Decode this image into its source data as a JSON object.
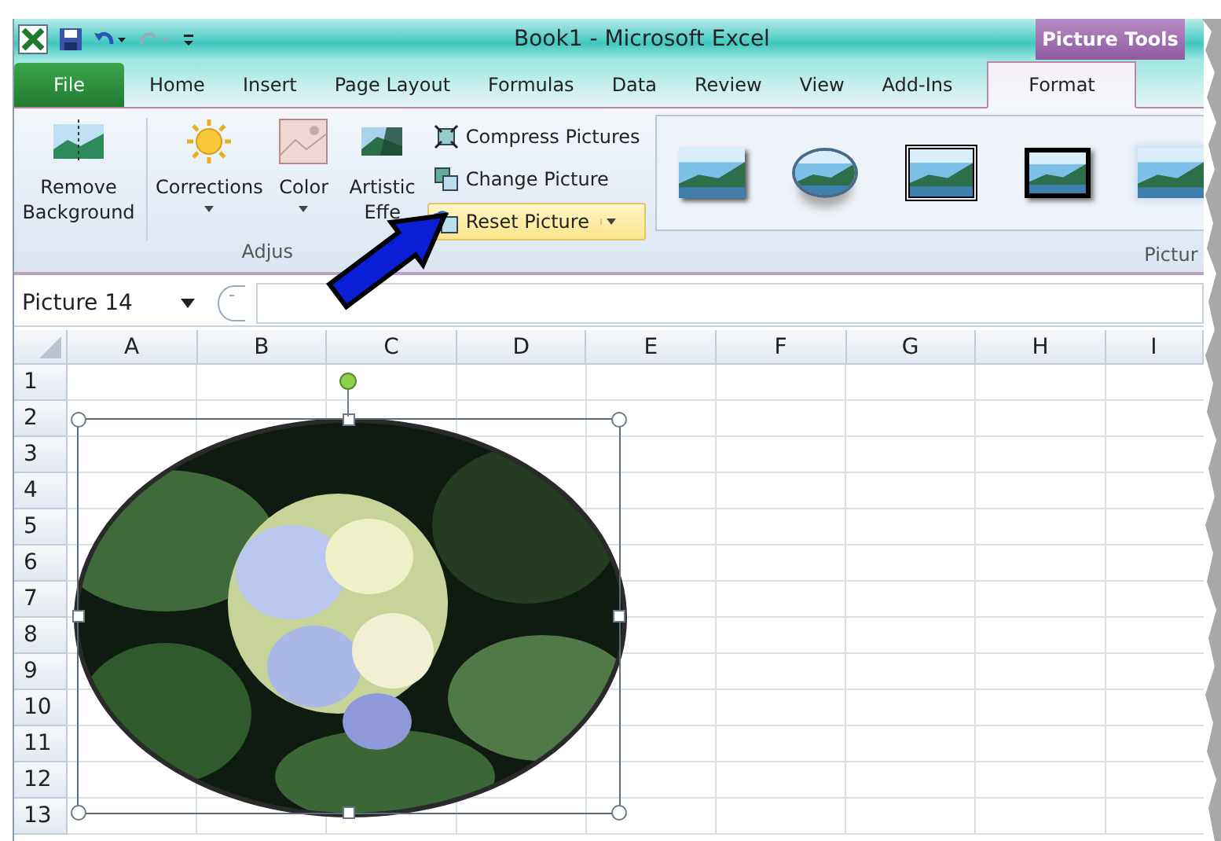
{
  "title_bar": {
    "title": "Book1 - Microsoft Excel",
    "context_tab": "Picture Tools"
  },
  "tabs": [
    {
      "label": "File",
      "kind": "file",
      "selected": false
    },
    {
      "label": "Home",
      "kind": "tab",
      "selected": false
    },
    {
      "label": "Insert",
      "kind": "tab",
      "selected": false
    },
    {
      "label": "Page Layout",
      "kind": "tab",
      "selected": false
    },
    {
      "label": "Formulas",
      "kind": "tab",
      "selected": false
    },
    {
      "label": "Data",
      "kind": "tab",
      "selected": false
    },
    {
      "label": "Review",
      "kind": "tab",
      "selected": false
    },
    {
      "label": "View",
      "kind": "tab",
      "selected": false
    },
    {
      "label": "Add-Ins",
      "kind": "tab",
      "selected": false
    },
    {
      "label": "Format",
      "kind": "context",
      "selected": true
    }
  ],
  "ribbon": {
    "big_buttons": [
      {
        "label": "Remove Background",
        "kind": "remove",
        "dropdown": false
      },
      {
        "label": "Corrections",
        "kind": "sun",
        "dropdown": true
      },
      {
        "label": "Color",
        "kind": "color",
        "dropdown": true
      },
      {
        "label": "Artistic Effe",
        "kind": "artistic",
        "dropdown": false
      }
    ],
    "small_buttons": [
      {
        "label": "Compress Pictures",
        "kind": "compress",
        "highlighted": false,
        "split": false
      },
      {
        "label": "Change Picture",
        "kind": "change",
        "highlighted": false,
        "split": false
      },
      {
        "label": "Reset Picture",
        "kind": "reset",
        "highlighted": true,
        "split": true
      }
    ],
    "group_label": "Adjus",
    "styles": [
      {
        "kind": "shadow"
      },
      {
        "kind": "oval"
      },
      {
        "kind": "double-frame"
      },
      {
        "kind": "black-frame"
      },
      {
        "kind": "soft-edge"
      }
    ],
    "styles_group_label": "Pictur"
  },
  "name_box": {
    "value": "Picture 14"
  },
  "columns": [
    "A",
    "B",
    "C",
    "D",
    "E",
    "F",
    "G",
    "H",
    "I"
  ],
  "rows": [
    "1",
    "2",
    "3",
    "4",
    "5",
    "6",
    "7",
    "8",
    "9",
    "10",
    "11",
    "12",
    "13"
  ],
  "picture": {
    "kind": "picture",
    "selected": true
  }
}
